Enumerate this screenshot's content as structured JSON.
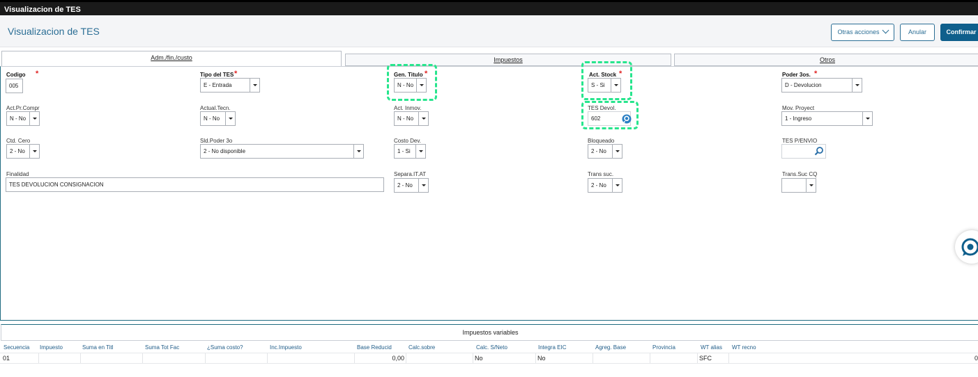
{
  "window": {
    "title": "Visualizacion de TES"
  },
  "header": {
    "title": "Visualizacion de TES",
    "otras_acciones": "Otras acciones",
    "anular": "Anular",
    "confirmar": "Confirmar"
  },
  "tabs": {
    "adm": "Adm./fin./custo",
    "impuestos": "Impuestos",
    "otros": "Otros"
  },
  "fields": {
    "codigo": {
      "label": "Codigo",
      "value": "005"
    },
    "tipo_tes": {
      "label": "Tipo del TES",
      "value": "E - Entrada"
    },
    "gen_titulo": {
      "label": "Gen. Titulo",
      "value": "N - No"
    },
    "act_stock": {
      "label": "Act. Stock",
      "value": "S - Si"
    },
    "poder_3os": {
      "label": "Poder 3os.",
      "value": "D - Devolucion"
    },
    "act_pr_compr": {
      "label": "Act.Pr.Compr",
      "value": "N - No"
    },
    "actual_tecn": {
      "label": "Actual.Tecn.",
      "value": "N - No"
    },
    "act_inmov": {
      "label": "Act. Inmov.",
      "value": "N - No"
    },
    "tes_devol": {
      "label": "TES Devol.",
      "value": "602"
    },
    "mov_proyect": {
      "label": "Mov. Proyect",
      "value": "1 - Ingreso"
    },
    "ctd_cero": {
      "label": "Ctd. Cero",
      "value": "2 - No"
    },
    "sld_poder_3o": {
      "label": "Sld.Poder 3o",
      "value": "2 - No disponible"
    },
    "costo_dev": {
      "label": "Costo Dev.",
      "value": "1 - Si"
    },
    "bloqueado": {
      "label": "Bloqueado",
      "value": "2 - No"
    },
    "tes_penvio": {
      "label": "TES P/ENVIO",
      "value": ""
    },
    "finalidad": {
      "label": "Finalidad",
      "value": "TES DEVOLUCION CONSIGNACION"
    },
    "separa_it_at": {
      "label": "Separa.IT.AT",
      "value": "2 - No"
    },
    "trans_suc": {
      "label": "Trans suc.",
      "value": "2 - No"
    },
    "trans_suc_cq": {
      "label": "Trans.Suc CQ",
      "value": ""
    }
  },
  "required_mark": "*",
  "impuestos_variables": {
    "title": "Impuestos variables",
    "columns": [
      "Secuencia",
      "Impuesto",
      "Suma en Titl",
      "Suma Tot Fac",
      "¿Suma costo?",
      "Inc.Impuesto",
      "Base Reducid",
      "Calc.sobre",
      "Calc. S/Neto",
      "Integra EIC",
      "Agreg. Base",
      "Provincia",
      "WT alias",
      "WT recno"
    ],
    "row": {
      "secuencia": "01",
      "base_reducid": "0,00",
      "calc_s_neto": "No",
      "integra_eic": "No",
      "wt_alias": "SFC",
      "wt_recno": "0"
    }
  },
  "colors": {
    "accent": "#2b6e95",
    "highlight": "#27e58d",
    "required": "#e02424"
  }
}
